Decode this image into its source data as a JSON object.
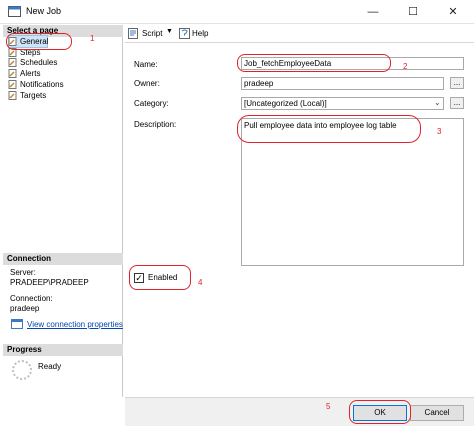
{
  "window": {
    "title": "New Job",
    "minimize": "—",
    "maximize": "☐",
    "close": "✕"
  },
  "left_pane": {
    "select_page_header": "Select a page",
    "pages": [
      {
        "label": "General"
      },
      {
        "label": "Steps"
      },
      {
        "label": "Schedules"
      },
      {
        "label": "Alerts"
      },
      {
        "label": "Notifications"
      },
      {
        "label": "Targets"
      }
    ],
    "connection_header": "Connection",
    "server_label": "Server:",
    "server_value": "PRADEEP\\PRADEEP",
    "connection_label": "Connection:",
    "connection_value": "pradeep",
    "view_connection_link": "View connection properties",
    "progress_header": "Progress",
    "progress_status": "Ready"
  },
  "toolbar": {
    "script_label": "Script",
    "help_label": "Help"
  },
  "form": {
    "name_label": "Name:",
    "name_value": "Job_fetchEmployeeData",
    "owner_label": "Owner:",
    "owner_value": "pradeep",
    "category_label": "Category:",
    "category_value": "[Uncategorized (Local)]",
    "description_label": "Description:",
    "description_value": "Pull employee data into employee log table",
    "enabled_label": "Enabled",
    "enabled_checked": true,
    "ellipsis": "..."
  },
  "buttons": {
    "ok_label": "OK",
    "cancel_label": "Cancel"
  },
  "annotations": {
    "n1": "1",
    "n2": "2",
    "n3": "3",
    "n4": "4",
    "n5": "5",
    "color": "#e0232a"
  }
}
